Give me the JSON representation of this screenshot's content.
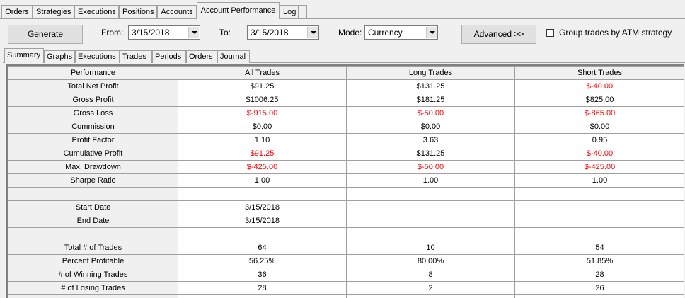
{
  "top_tabs": [
    {
      "label": "Orders",
      "active": false
    },
    {
      "label": "Strategies",
      "active": false
    },
    {
      "label": "Executions",
      "active": false
    },
    {
      "label": "Positions",
      "active": false
    },
    {
      "label": "Accounts",
      "active": false
    },
    {
      "label": "Account Performance",
      "active": true
    },
    {
      "label": "Log",
      "active": false
    }
  ],
  "toolbar": {
    "generate_label": "Generate",
    "from_label": "From:",
    "from_value": "3/15/2018",
    "to_label": "To:",
    "to_value": "3/15/2018",
    "mode_label": "Mode:",
    "mode_value": "Currency",
    "advanced_label": "Advanced >>",
    "group_trades_label": "Group trades by ATM strategy",
    "group_trades_checked": false
  },
  "sub_tabs": [
    {
      "label": "Summary",
      "active": true
    },
    {
      "label": "Graphs",
      "active": false
    },
    {
      "label": "Executions",
      "active": false
    },
    {
      "label": "Trades",
      "active": false
    },
    {
      "label": "Periods",
      "active": false
    },
    {
      "label": "Orders",
      "active": false
    },
    {
      "label": "Journal",
      "active": false
    }
  ],
  "table": {
    "headers": [
      "Performance",
      "All Trades",
      "Long Trades",
      "Short Trades"
    ],
    "rows": [
      [
        "Total Net Profit",
        "$91.25",
        "$131.25",
        "$-40.00"
      ],
      [
        "Gross Profit",
        "$1006.25",
        "$181.25",
        "$825.00"
      ],
      [
        "Gross Loss",
        "$-915.00",
        "$-50.00",
        "$-865.00"
      ],
      [
        "Commission",
        "$0.00",
        "$0.00",
        "$0.00"
      ],
      [
        "Profit Factor",
        "1.10",
        "3.63",
        "0.95"
      ],
      [
        "Cumulative Profit",
        "$91.25",
        "$131.25",
        "$-40.00"
      ],
      [
        "Max. Drawdown",
        "$-425.00",
        "$-50.00",
        "$-425.00"
      ],
      [
        "Sharpe Ratio",
        "1.00",
        "1.00",
        "1.00"
      ],
      [
        "",
        "",
        "",
        ""
      ],
      [
        "Start Date",
        "3/15/2018",
        "",
        ""
      ],
      [
        "End Date",
        "3/15/2018",
        "",
        ""
      ],
      [
        "",
        "",
        "",
        ""
      ],
      [
        "Total # of Trades",
        "64",
        "10",
        "54"
      ],
      [
        "Percent Profitable",
        "56.25%",
        "80.00%",
        "51.85%"
      ],
      [
        "# of Winning Trades",
        "36",
        "8",
        "28"
      ],
      [
        "# of Losing Trades",
        "28",
        "2",
        "26"
      ],
      [
        "",
        "",
        "",
        ""
      ]
    ],
    "red_cells": [
      [
        0,
        3
      ],
      [
        2,
        1
      ],
      [
        2,
        2
      ],
      [
        2,
        3
      ],
      [
        5,
        1
      ],
      [
        5,
        3
      ],
      [
        6,
        1
      ],
      [
        6,
        2
      ],
      [
        6,
        3
      ]
    ]
  },
  "colors": {
    "negative_value": "#ff0000",
    "panel_background": "#f0f0f0",
    "grid_background": "#ffffff"
  }
}
